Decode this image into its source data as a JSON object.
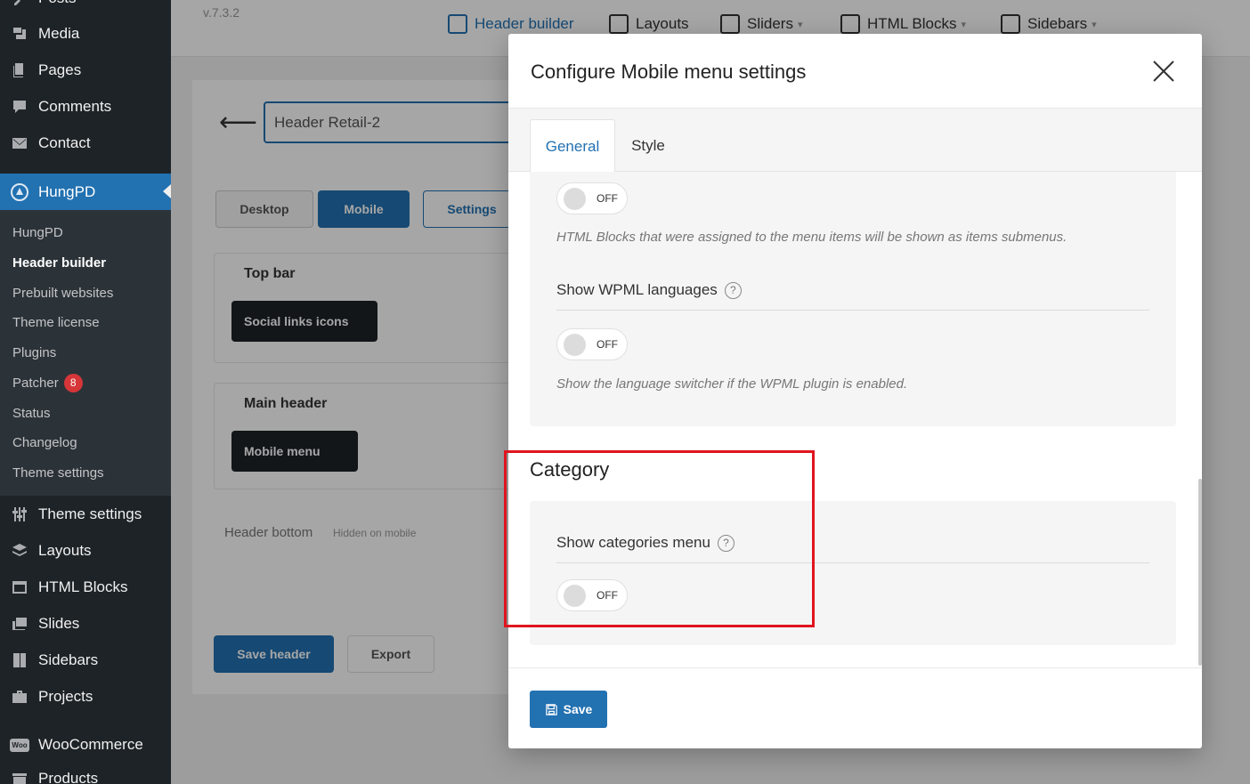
{
  "sidebar": {
    "menu": [
      {
        "label": "Posts",
        "icon": "pin-icon"
      },
      {
        "label": "Media",
        "icon": "media-icon"
      },
      {
        "label": "Pages",
        "icon": "pages-icon"
      },
      {
        "label": "Comments",
        "icon": "comments-icon"
      },
      {
        "label": "Contact",
        "icon": "mail-icon"
      },
      {
        "label": "HungPD",
        "icon": "hungpd-icon"
      },
      {
        "label": "Theme settings",
        "icon": "sliders-icon"
      },
      {
        "label": "Layouts",
        "icon": "layers-icon"
      },
      {
        "label": "HTML Blocks",
        "icon": "html-block-icon"
      },
      {
        "label": "Slides",
        "icon": "slides-icon"
      },
      {
        "label": "Sidebars",
        "icon": "sidebar-icon"
      },
      {
        "label": "Projects",
        "icon": "briefcase-icon"
      },
      {
        "label": "WooCommerce",
        "icon": "woo-icon"
      },
      {
        "label": "Products",
        "icon": "products-icon"
      }
    ],
    "woo_icon_text": "Woo",
    "submenu": [
      {
        "label": "HungPD"
      },
      {
        "label": "Header builder"
      },
      {
        "label": "Prebuilt websites"
      },
      {
        "label": "Theme license"
      },
      {
        "label": "Plugins"
      },
      {
        "label": "Patcher",
        "badge": "8"
      },
      {
        "label": "Status"
      },
      {
        "label": "Changelog"
      },
      {
        "label": "Theme settings"
      }
    ]
  },
  "background": {
    "version": "v.7.3.2",
    "nav": [
      "Header builder",
      "Layouts",
      "Sliders",
      "HTML Blocks",
      "Sidebars"
    ],
    "header_name": "Header Retail-2",
    "view_buttons": [
      "Desktop",
      "Mobile",
      "Settings"
    ],
    "rows": {
      "top_bar": "Top bar",
      "top_bar_chip": "Social links icons",
      "main_header": "Main header",
      "main_header_chip": "Mobile menu",
      "header_bottom": "Header bottom",
      "hidden_on_mobile": "Hidden on mobile"
    },
    "save_header": "Save header",
    "export": "Export"
  },
  "modal": {
    "title": "Configure Mobile menu settings",
    "tabs": [
      "General",
      "Style"
    ],
    "fields": {
      "html_blocks_toggle": "OFF",
      "html_blocks_help": "HTML Blocks that were assigned to the menu items will be shown as items submenus.",
      "wpml_label": "Show WPML languages",
      "wpml_toggle": "OFF",
      "wpml_help": "Show the language switcher if the WPML plugin is enabled.",
      "category_title": "Category",
      "categories_label": "Show categories menu",
      "categories_toggle": "OFF"
    },
    "help_mark": "?",
    "save": "Save"
  },
  "colors": {
    "accent": "#2271b1",
    "sidebar_bg": "#1d2327",
    "highlight": "#e0141e",
    "badge": "#d63638"
  }
}
